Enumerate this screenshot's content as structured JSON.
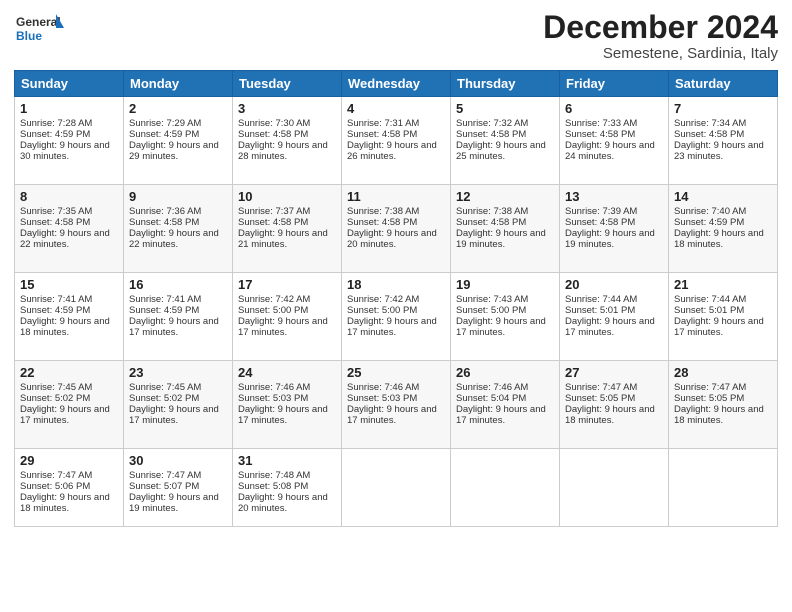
{
  "logo": {
    "line1": "General",
    "line2": "Blue"
  },
  "title": "December 2024",
  "location": "Semestene, Sardinia, Italy",
  "weekdays": [
    "Sunday",
    "Monday",
    "Tuesday",
    "Wednesday",
    "Thursday",
    "Friday",
    "Saturday"
  ],
  "weeks": [
    [
      {
        "day": "1",
        "sunrise": "Sunrise: 7:28 AM",
        "sunset": "Sunset: 4:59 PM",
        "daylight": "Daylight: 9 hours and 30 minutes."
      },
      {
        "day": "2",
        "sunrise": "Sunrise: 7:29 AM",
        "sunset": "Sunset: 4:59 PM",
        "daylight": "Daylight: 9 hours and 29 minutes."
      },
      {
        "day": "3",
        "sunrise": "Sunrise: 7:30 AM",
        "sunset": "Sunset: 4:58 PM",
        "daylight": "Daylight: 9 hours and 28 minutes."
      },
      {
        "day": "4",
        "sunrise": "Sunrise: 7:31 AM",
        "sunset": "Sunset: 4:58 PM",
        "daylight": "Daylight: 9 hours and 26 minutes."
      },
      {
        "day": "5",
        "sunrise": "Sunrise: 7:32 AM",
        "sunset": "Sunset: 4:58 PM",
        "daylight": "Daylight: 9 hours and 25 minutes."
      },
      {
        "day": "6",
        "sunrise": "Sunrise: 7:33 AM",
        "sunset": "Sunset: 4:58 PM",
        "daylight": "Daylight: 9 hours and 24 minutes."
      },
      {
        "day": "7",
        "sunrise": "Sunrise: 7:34 AM",
        "sunset": "Sunset: 4:58 PM",
        "daylight": "Daylight: 9 hours and 23 minutes."
      }
    ],
    [
      {
        "day": "8",
        "sunrise": "Sunrise: 7:35 AM",
        "sunset": "Sunset: 4:58 PM",
        "daylight": "Daylight: 9 hours and 22 minutes."
      },
      {
        "day": "9",
        "sunrise": "Sunrise: 7:36 AM",
        "sunset": "Sunset: 4:58 PM",
        "daylight": "Daylight: 9 hours and 22 minutes."
      },
      {
        "day": "10",
        "sunrise": "Sunrise: 7:37 AM",
        "sunset": "Sunset: 4:58 PM",
        "daylight": "Daylight: 9 hours and 21 minutes."
      },
      {
        "day": "11",
        "sunrise": "Sunrise: 7:38 AM",
        "sunset": "Sunset: 4:58 PM",
        "daylight": "Daylight: 9 hours and 20 minutes."
      },
      {
        "day": "12",
        "sunrise": "Sunrise: 7:38 AM",
        "sunset": "Sunset: 4:58 PM",
        "daylight": "Daylight: 9 hours and 19 minutes."
      },
      {
        "day": "13",
        "sunrise": "Sunrise: 7:39 AM",
        "sunset": "Sunset: 4:58 PM",
        "daylight": "Daylight: 9 hours and 19 minutes."
      },
      {
        "day": "14",
        "sunrise": "Sunrise: 7:40 AM",
        "sunset": "Sunset: 4:59 PM",
        "daylight": "Daylight: 9 hours and 18 minutes."
      }
    ],
    [
      {
        "day": "15",
        "sunrise": "Sunrise: 7:41 AM",
        "sunset": "Sunset: 4:59 PM",
        "daylight": "Daylight: 9 hours and 18 minutes."
      },
      {
        "day": "16",
        "sunrise": "Sunrise: 7:41 AM",
        "sunset": "Sunset: 4:59 PM",
        "daylight": "Daylight: 9 hours and 17 minutes."
      },
      {
        "day": "17",
        "sunrise": "Sunrise: 7:42 AM",
        "sunset": "Sunset: 5:00 PM",
        "daylight": "Daylight: 9 hours and 17 minutes."
      },
      {
        "day": "18",
        "sunrise": "Sunrise: 7:42 AM",
        "sunset": "Sunset: 5:00 PM",
        "daylight": "Daylight: 9 hours and 17 minutes."
      },
      {
        "day": "19",
        "sunrise": "Sunrise: 7:43 AM",
        "sunset": "Sunset: 5:00 PM",
        "daylight": "Daylight: 9 hours and 17 minutes."
      },
      {
        "day": "20",
        "sunrise": "Sunrise: 7:44 AM",
        "sunset": "Sunset: 5:01 PM",
        "daylight": "Daylight: 9 hours and 17 minutes."
      },
      {
        "day": "21",
        "sunrise": "Sunrise: 7:44 AM",
        "sunset": "Sunset: 5:01 PM",
        "daylight": "Daylight: 9 hours and 17 minutes."
      }
    ],
    [
      {
        "day": "22",
        "sunrise": "Sunrise: 7:45 AM",
        "sunset": "Sunset: 5:02 PM",
        "daylight": "Daylight: 9 hours and 17 minutes."
      },
      {
        "day": "23",
        "sunrise": "Sunrise: 7:45 AM",
        "sunset": "Sunset: 5:02 PM",
        "daylight": "Daylight: 9 hours and 17 minutes."
      },
      {
        "day": "24",
        "sunrise": "Sunrise: 7:46 AM",
        "sunset": "Sunset: 5:03 PM",
        "daylight": "Daylight: 9 hours and 17 minutes."
      },
      {
        "day": "25",
        "sunrise": "Sunrise: 7:46 AM",
        "sunset": "Sunset: 5:03 PM",
        "daylight": "Daylight: 9 hours and 17 minutes."
      },
      {
        "day": "26",
        "sunrise": "Sunrise: 7:46 AM",
        "sunset": "Sunset: 5:04 PM",
        "daylight": "Daylight: 9 hours and 17 minutes."
      },
      {
        "day": "27",
        "sunrise": "Sunrise: 7:47 AM",
        "sunset": "Sunset: 5:05 PM",
        "daylight": "Daylight: 9 hours and 18 minutes."
      },
      {
        "day": "28",
        "sunrise": "Sunrise: 7:47 AM",
        "sunset": "Sunset: 5:05 PM",
        "daylight": "Daylight: 9 hours and 18 minutes."
      }
    ],
    [
      {
        "day": "29",
        "sunrise": "Sunrise: 7:47 AM",
        "sunset": "Sunset: 5:06 PM",
        "daylight": "Daylight: 9 hours and 18 minutes."
      },
      {
        "day": "30",
        "sunrise": "Sunrise: 7:47 AM",
        "sunset": "Sunset: 5:07 PM",
        "daylight": "Daylight: 9 hours and 19 minutes."
      },
      {
        "day": "31",
        "sunrise": "Sunrise: 7:48 AM",
        "sunset": "Sunset: 5:08 PM",
        "daylight": "Daylight: 9 hours and 20 minutes."
      },
      null,
      null,
      null,
      null
    ]
  ]
}
